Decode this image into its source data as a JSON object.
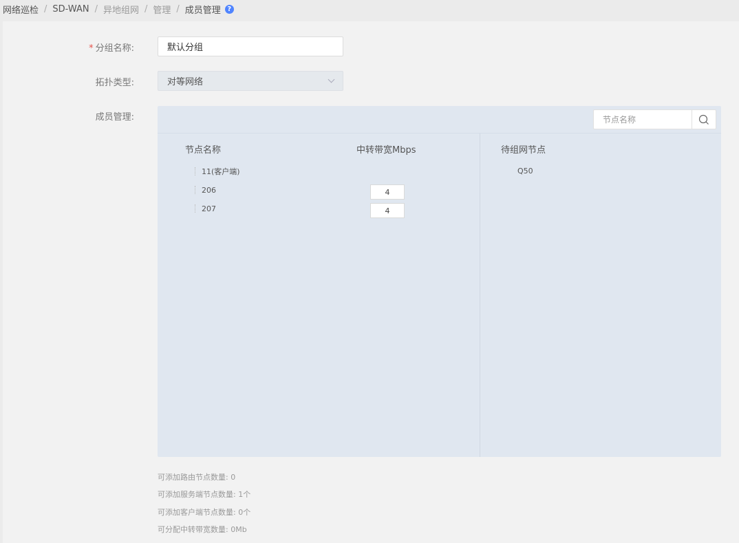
{
  "breadcrumb": {
    "items": [
      "网络巡检",
      "SD-WAN",
      "异地组网",
      "管理",
      "成员管理"
    ],
    "help": "?"
  },
  "form": {
    "group_name": {
      "label": "分组名称:",
      "required_mark": "*",
      "value": "默认分组"
    },
    "topology": {
      "label": "拓扑类型:",
      "value": "对等网络"
    },
    "members_label": "成员管理:"
  },
  "member_panel": {
    "search_placeholder": "节点名称",
    "columns": {
      "node_name": "节点名称",
      "relay_bandwidth": "中转带宽Mbps",
      "pending": "待组网节点"
    },
    "nodes": [
      {
        "name": "11(客户端)",
        "bandwidth": ""
      },
      {
        "name": "206",
        "bandwidth": "4"
      },
      {
        "name": "207",
        "bandwidth": "4"
      }
    ],
    "pending_nodes": [
      "Q50"
    ]
  },
  "stats": [
    "可添加路由节点数量: 0",
    "可添加服务端节点数量: 1个",
    "可添加客户端节点数量: 0个",
    "可分配中转带宽数量: 0Mb"
  ],
  "colors": {
    "help_icon": "#4f84ff",
    "required": "#e5534b",
    "panel_bg": "#e0e7f0"
  },
  "icons": {
    "search": "search-icon",
    "dropdown": "chevron-down-icon",
    "help": "help-icon"
  }
}
